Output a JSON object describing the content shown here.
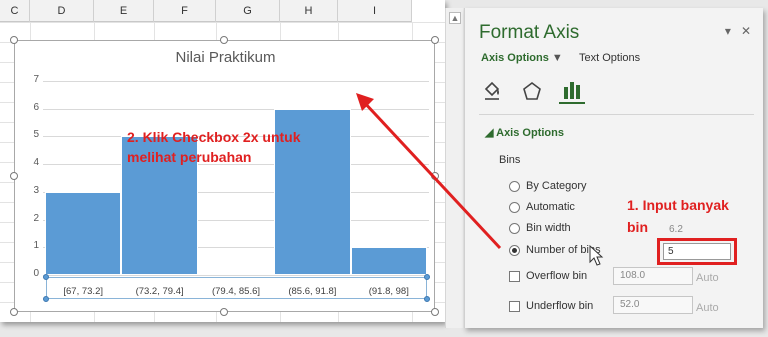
{
  "sheet": {
    "columns": [
      "C",
      "D",
      "E",
      "F",
      "G",
      "H",
      "I"
    ]
  },
  "chart_data": {
    "type": "bar",
    "title": "Nilai Praktikum",
    "categories": [
      "[67, 73.2]",
      "(73.2, 79.4]",
      "(79.4, 85.6]",
      "(85.6, 91.8]",
      "(91.8, 98]"
    ],
    "values": [
      3,
      5,
      0,
      6,
      1
    ],
    "ylim": [
      0,
      7
    ],
    "yticks": [
      "0",
      "1",
      "2",
      "3",
      "4",
      "5",
      "6",
      "7"
    ],
    "color": "#5b9bd5",
    "grid": true
  },
  "annotations": {
    "step2_line1": "2. Klik Checkbox 2x untuk",
    "step2_line2": "melihat perubahan",
    "step1_line1": "1. Input banyak",
    "step1_line2": "bin",
    "color": "#e02020"
  },
  "panel": {
    "title": "Format Axis",
    "dropdown_icon": "chevron-down-icon",
    "close_label": "✕",
    "tabs": {
      "axis_options": "Axis Options",
      "text_options": "Text Options"
    },
    "icons": [
      "fill-line-icon",
      "effects-icon",
      "axis-options-icon"
    ],
    "section": "Axis Options",
    "bins_label": "Bins",
    "options": {
      "by_category": "By Category",
      "automatic": "Automatic",
      "bin_width": "Bin width",
      "bin_width_value": "6.2",
      "number_of_bins": "Number of bins",
      "number_of_bins_value": "5",
      "overflow": "Overflow bin",
      "overflow_value": "108.0",
      "underflow": "Underflow bin",
      "underflow_value": "52.0",
      "auto": "Auto"
    },
    "accent": "#2e6b2e"
  }
}
